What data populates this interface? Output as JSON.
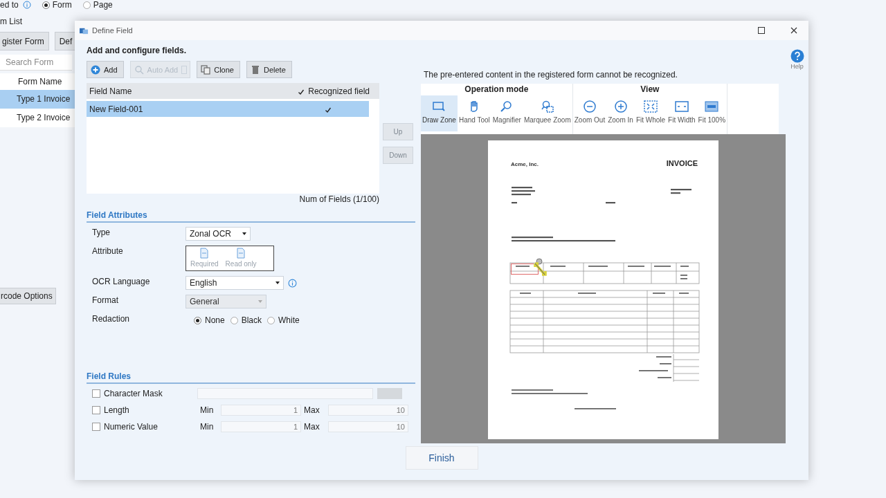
{
  "background_app": {
    "route_label": "ed to",
    "route_options": [
      {
        "label": "Form",
        "selected": true
      },
      {
        "label": "Page",
        "selected": false
      }
    ],
    "list_title": "m List",
    "buttons": [
      "gister Form",
      "Def"
    ],
    "search_placeholder": "Search Form",
    "column": "Form Name",
    "forms": [
      {
        "name": "Type 1 Invoice",
        "selected": true
      },
      {
        "name": "Type 2 Invoice",
        "selected": false
      }
    ],
    "options_button": "rcode Options"
  },
  "dialog": {
    "title": "Define Field",
    "heading": "Add and configure fields.",
    "toolbar": [
      {
        "kind": "add",
        "label": "Add",
        "disabled": false
      },
      {
        "kind": "auto-add",
        "label": "Auto Add",
        "disabled": true
      },
      {
        "kind": "clone",
        "label": "Clone",
        "disabled": false
      },
      {
        "kind": "delete",
        "label": "Delete",
        "disabled": false
      }
    ],
    "field_list": {
      "columns": [
        "Field Name",
        "Recognized field"
      ],
      "header_checked": true,
      "rows": [
        {
          "name": "New Field-001",
          "recognized": true,
          "selected": true
        }
      ],
      "count": "Num of Fields (1/100)"
    },
    "move_buttons": [
      {
        "label": "Up",
        "disabled": true
      },
      {
        "label": "Down",
        "disabled": true
      }
    ],
    "field_attributes": {
      "title": "Field Attributes",
      "rows": [
        {
          "kind": "dropdown",
          "label": "Type",
          "value": "Zonal OCR",
          "disabled": false
        },
        {
          "kind": "toggles",
          "label": "Attribute",
          "options": [
            {
              "label": "Required",
              "on": false
            },
            {
              "label": "Read only",
              "on": false
            }
          ]
        },
        {
          "kind": "dropdown",
          "label": "OCR Language",
          "value": "English",
          "disabled": false,
          "info": true
        },
        {
          "kind": "dropdown",
          "label": "Format",
          "value": "General",
          "disabled": true
        },
        {
          "kind": "radios",
          "label": "Redaction",
          "options": [
            {
              "label": "None",
              "selected": true
            },
            {
              "label": "Black",
              "selected": false
            },
            {
              "label": "White",
              "selected": false
            }
          ]
        }
      ]
    },
    "field_rules": {
      "title": "Field Rules",
      "rows": [
        {
          "kind": "mask",
          "label": "Character Mask",
          "checked": false
        },
        {
          "kind": "range",
          "label": "Length",
          "checked": false,
          "min_label": "Min",
          "min": "1",
          "max_label": "Max",
          "max": "10"
        },
        {
          "kind": "range",
          "label": "Numeric Value",
          "checked": false,
          "min_label": "Min",
          "min": "1",
          "max_label": "Max",
          "max": "10"
        }
      ]
    },
    "finish": "Finish",
    "viewer": {
      "message": "The pre-entered content in the registered form cannot be recognized.",
      "groups": [
        {
          "title": "Operation mode",
          "tools": [
            {
              "kind": "draw-zone",
              "label": "Draw Zone",
              "selected": true
            },
            {
              "kind": "hand",
              "label": "Hand Tool",
              "selected": false
            },
            {
              "kind": "magnifier",
              "label": "Magnifier",
              "selected": false
            },
            {
              "kind": "marquee",
              "label": "Marquee Zoom",
              "selected": false
            }
          ]
        },
        {
          "title": "View",
          "tools": [
            {
              "kind": "zoom-out",
              "label": "Zoom Out",
              "selected": false
            },
            {
              "kind": "zoom-in",
              "label": "Zoom In",
              "selected": false
            },
            {
              "kind": "fit-whole",
              "label": "Fit Whole",
              "selected": false
            },
            {
              "kind": "fit-width",
              "label": "Fit Width",
              "selected": false
            },
            {
              "kind": "fit-100",
              "label": "Fit 100%",
              "selected": false
            }
          ]
        }
      ],
      "document": {
        "company": "Acme, Inc.",
        "title": "INVOICE"
      }
    },
    "help": "Help"
  }
}
